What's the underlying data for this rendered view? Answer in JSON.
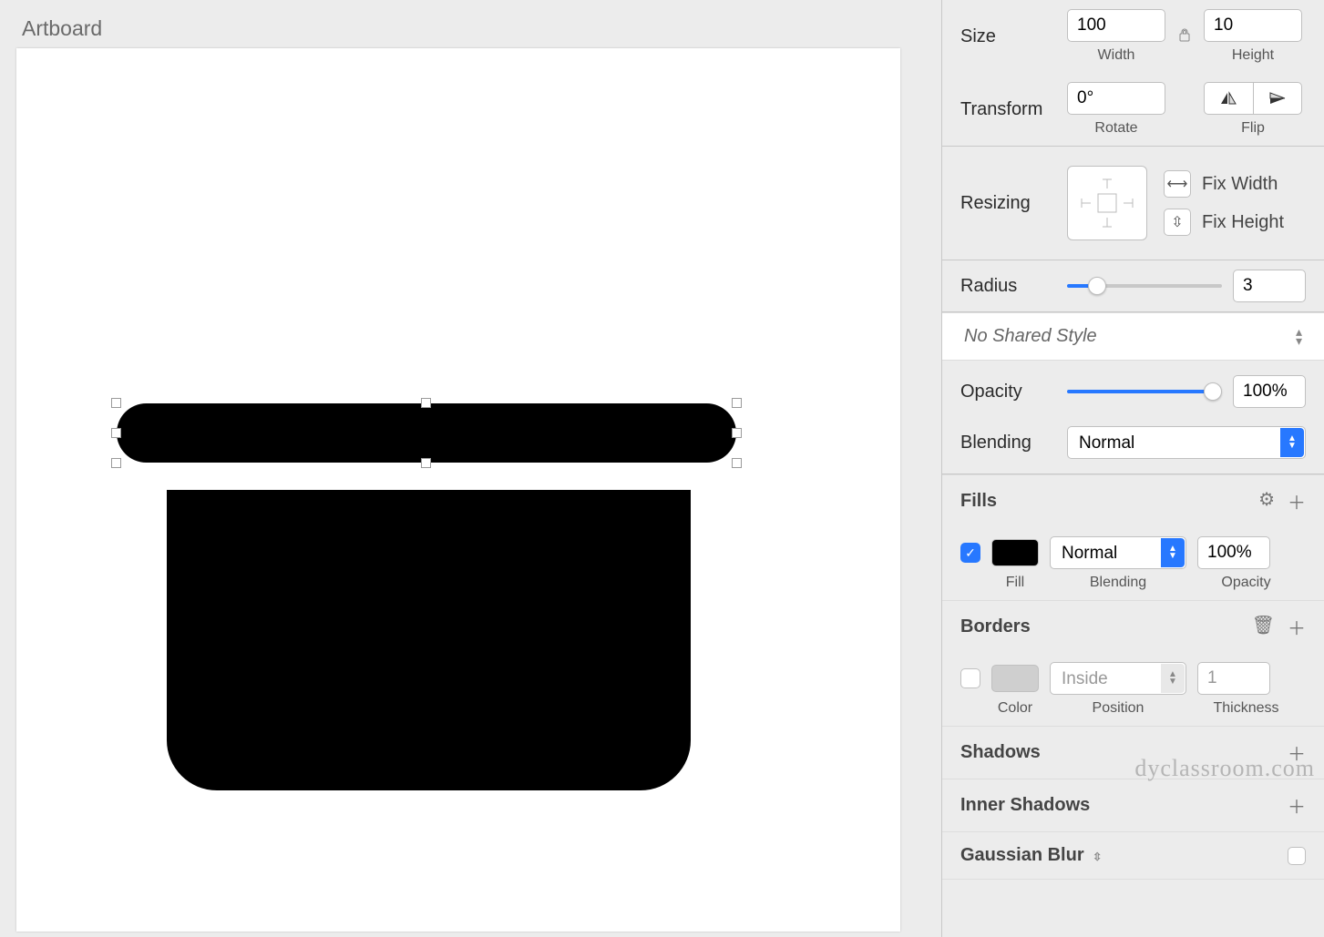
{
  "artboard": {
    "label": "Artboard"
  },
  "size": {
    "label": "Size",
    "width": "100",
    "widthCaption": "Width",
    "height": "10",
    "heightCaption": "Height"
  },
  "transform": {
    "label": "Transform",
    "rotate": "0°",
    "rotateCaption": "Rotate",
    "flipCaption": "Flip"
  },
  "resizing": {
    "label": "Resizing",
    "fixWidth": "Fix Width",
    "fixHeight": "Fix Height"
  },
  "radius": {
    "label": "Radius",
    "value": "3"
  },
  "sharedStyle": {
    "text": "No Shared Style"
  },
  "opacity": {
    "label": "Opacity",
    "value": "100%"
  },
  "blending": {
    "label": "Blending",
    "value": "Normal"
  },
  "fills": {
    "title": "Fills",
    "fillCaption": "Fill",
    "blendingCaption": "Blending",
    "opacityCaption": "Opacity",
    "blendValue": "Normal",
    "opacityValue": "100%"
  },
  "borders": {
    "title": "Borders",
    "colorCaption": "Color",
    "positionCaption": "Position",
    "thicknessCaption": "Thickness",
    "positionValue": "Inside",
    "thicknessValue": "1"
  },
  "shadows": {
    "title": "Shadows"
  },
  "innerShadows": {
    "title": "Inner Shadows"
  },
  "gaussianBlur": {
    "title": "Gaussian Blur"
  },
  "watermark": "dyclassroom.com"
}
